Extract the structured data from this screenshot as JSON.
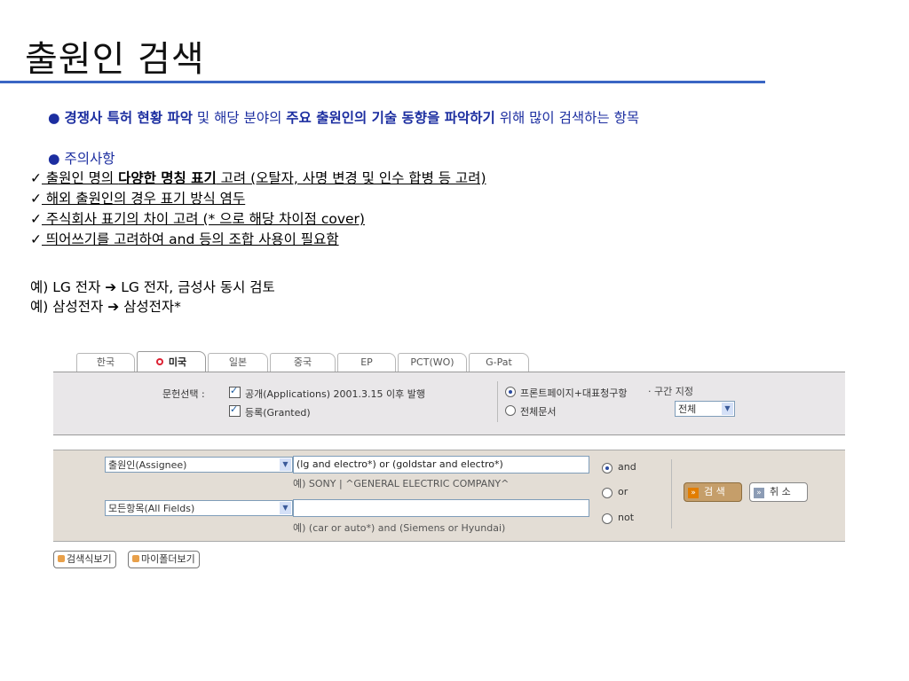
{
  "slide": {
    "title": "출원인 검색",
    "line1": {
      "b1": "경쟁사 특허 현황 파악",
      "t1": " 및 해당 분야의 ",
      "b2": "주요 출원인의 기술 동향을 파악하기",
      "t2": " 위해 많이 검색하는 항목"
    },
    "notes_heading": "주의사항",
    "notes": {
      "n1_a": " 출원인 명의 ",
      "n1_b": "다양한 명칭 표기",
      "n1_c": " 고려 (오탈자, 사명 변경 및 인수 합병 등 고려)",
      "n2": " 해외 출원인의 경우 표기 방식 염두",
      "n3": " 주식회사 표기의 차이 고려 (* 으로 해당 차이점 cover)",
      "n4": " 띄어쓰기를 고려하여 and 등의 조합 사용이 필요함"
    },
    "example1_a": "예) LG 전자 ",
    "example1_b": " LG 전자, 금성사 동시 검토",
    "example2_a": "예) 삼성전자 ",
    "example2_b": " 삼성전자*",
    "arrow": "➔",
    "check": "✓"
  },
  "search_ui": {
    "tabs": [
      "한국",
      "미국",
      "일본",
      "중국",
      "EP",
      "PCT(WO)",
      "G-Pat"
    ],
    "active_tab": "미국",
    "doc_select_label": "문헌선택 :",
    "doc_option1": "공개(Applications) 2001.3.15 이후 발행",
    "doc_option2": "등록(Granted)",
    "scope_option1": "프론트페이지+대표청구항",
    "scope_option2": "전체문서",
    "range_label": "· 구간 지정",
    "range_value": "전체",
    "field1_select": "출원인(Assignee)",
    "field1_value": "(lg and electro*) or (goldstar and electro*)",
    "field1_hint": "예) SONY | ^GENERAL ELECTRIC COMPANY^",
    "field2_select": "모든항목(All Fields)",
    "field2_value": "",
    "field2_hint": "예) (car or auto*) and (Siemens or Hyundai)",
    "op_and": "and",
    "op_or": "or",
    "op_not": "not",
    "search_btn": "검 색",
    "cancel_btn": "취 소",
    "chev": "»",
    "formula_btn": "검색식보기",
    "folder_btn": "마이폴더보기",
    "accent": "#3a66c4",
    "text_blue": "#1c2ea0"
  }
}
